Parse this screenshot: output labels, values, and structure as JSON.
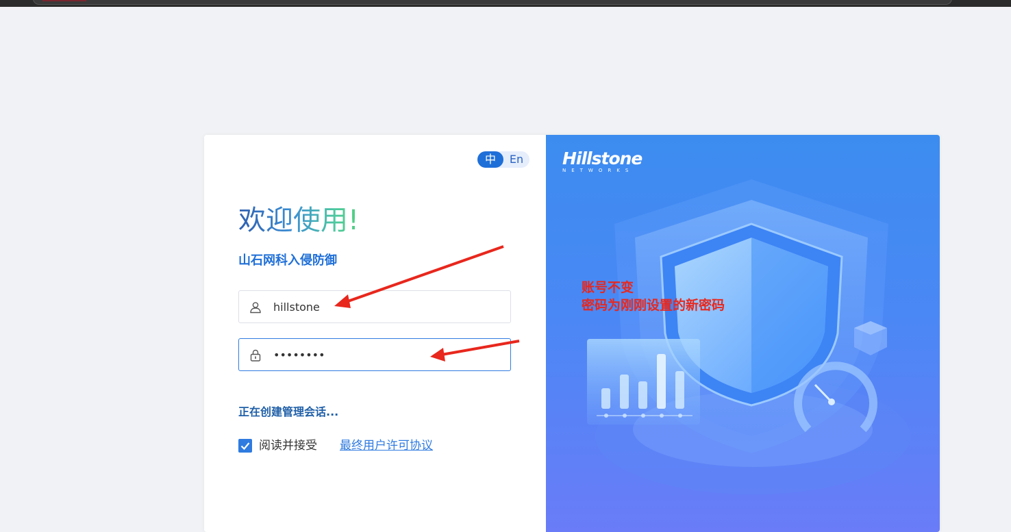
{
  "lang": {
    "zh": "中",
    "en": "En"
  },
  "welcome": "欢迎使用!",
  "product": "山石网科入侵防御",
  "username": {
    "value": "hillstone",
    "icon": "user-icon"
  },
  "password": {
    "value": "••••••••",
    "icon": "lock-icon"
  },
  "status": "正在创建管理会话...",
  "agree": {
    "label": "阅读并接受",
    "link": "最终用户许可协议",
    "checked": true
  },
  "brand": {
    "name": "Hillstone",
    "sub": "NETWORKS"
  },
  "annotation": {
    "line1": "账号不变",
    "line2": "密码为刚刚设置的新密码"
  },
  "colors": {
    "accent": "#1f6fd8",
    "annotation": "#e8271d",
    "panel": "#4a88f5"
  }
}
